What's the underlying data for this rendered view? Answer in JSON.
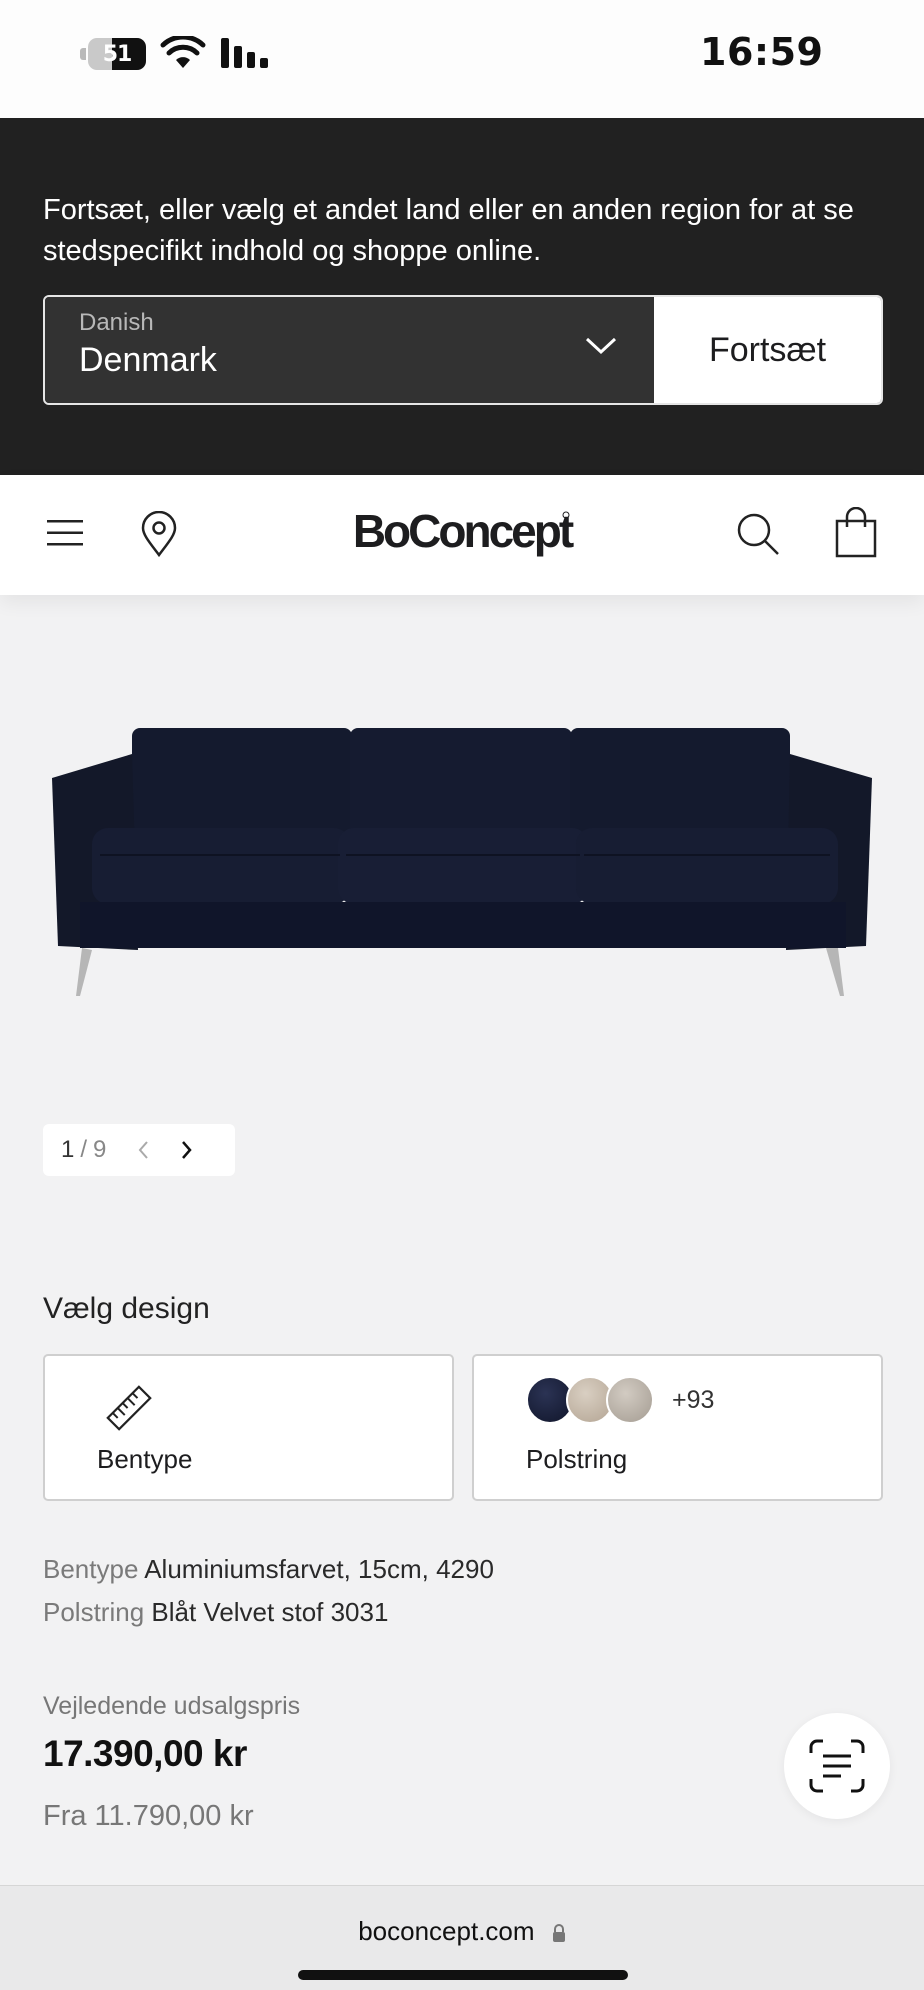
{
  "status_bar": {
    "time": "16:59",
    "battery_level": "51",
    "icons": [
      "battery-icon",
      "wifi-icon",
      "signal-icon"
    ]
  },
  "region_banner": {
    "message": "Fortsæt, eller vælg et andet land eller en anden region for at se stedspecifikt indhold og shoppe online.",
    "language": "Danish",
    "country": "Denmark",
    "continue_label": "Fortsæt"
  },
  "header": {
    "logo": "BoConcept",
    "icons": [
      "menu-icon",
      "location-pin-icon",
      "search-icon",
      "shopping-bag-icon"
    ]
  },
  "gallery": {
    "current": "1",
    "separator": "/",
    "total": "9"
  },
  "design": {
    "title": "Vælg design",
    "options": [
      {
        "label": "Bentype",
        "icon": "ruler-icon"
      },
      {
        "label": "Polstring",
        "more_count": "+93"
      }
    ]
  },
  "specs": [
    {
      "key": "Bentype",
      "value": "Aluminiumsfarvet, 15cm, 4290"
    },
    {
      "key": "Polstring",
      "value": "Blåt Velvet stof 3031"
    }
  ],
  "price": {
    "label": "Vejledende udsalgspris",
    "amount": "17.390,00 kr",
    "from": "Fra 11.790,00 kr"
  },
  "browser": {
    "url": "boconcept.com"
  },
  "colors": {
    "banner_bg": "#212121",
    "select_bg": "#323232",
    "page_bg": "#f2f2f3",
    "sofa": "#151a2d"
  }
}
